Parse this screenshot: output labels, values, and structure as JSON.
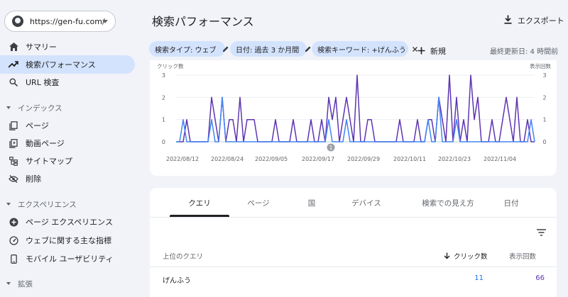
{
  "sidebar": {
    "property": "https://gen-fu.com/",
    "items": [
      {
        "label": "サマリー",
        "icon": "home-icon"
      },
      {
        "label": "検索パフォーマンス",
        "icon": "trending-icon",
        "active": true
      },
      {
        "label": "URL 検査",
        "icon": "search-icon"
      }
    ],
    "sections": [
      {
        "label": "インデックス",
        "items": [
          {
            "label": "ページ",
            "icon": "pages-icon"
          },
          {
            "label": "動画ページ",
            "icon": "video-page-icon"
          },
          {
            "label": "サイトマップ",
            "icon": "sitemap-icon"
          },
          {
            "label": "削除",
            "icon": "removal-icon"
          }
        ]
      },
      {
        "label": "エクスペリエンス",
        "items": [
          {
            "label": "ページ エクスペリエンス",
            "icon": "plus-circle-icon"
          },
          {
            "label": "ウェブに関する主な指標",
            "icon": "gauge-icon"
          },
          {
            "label": "モバイル ユーザビリティ",
            "icon": "mobile-icon"
          }
        ]
      },
      {
        "label": "拡張",
        "items": []
      }
    ]
  },
  "header": {
    "title": "検索パフォーマンス",
    "export_label": "エクスポート"
  },
  "filters": {
    "chips": [
      "検索タイプ: ウェブ",
      "日付: 過去 3 か月間",
      "検索キーワード: +げんふう"
    ],
    "new_label": "新規",
    "last_updated": "最終更新日: 4 時間前"
  },
  "chart_data": {
    "type": "line",
    "ylabel_left": "クリック数",
    "ylabel_right": "表示回数",
    "yticks_left": [
      "3",
      "2",
      "1",
      "0"
    ],
    "yticks_right": [
      "3",
      "2",
      "1",
      "0"
    ],
    "ylim": [
      0,
      3
    ],
    "x_tick_labels": [
      "2022/08/12",
      "2022/08/24",
      "2022/09/05",
      "2022/09/17",
      "2022/09/29",
      "2022/10/11",
      "2022/10/23",
      "2022/11/04"
    ],
    "annotation": "1",
    "series": [
      {
        "name": "クリック数",
        "color": "#4285f4",
        "values": [
          0,
          0,
          1,
          0,
          0,
          0,
          0,
          0,
          0,
          0,
          1,
          0,
          0,
          2,
          0,
          0,
          0,
          0,
          0,
          0,
          0,
          0,
          0,
          0,
          0,
          0,
          0,
          0,
          0,
          0,
          0,
          0,
          0,
          0,
          0,
          0,
          0,
          0,
          0,
          0,
          0,
          0,
          0,
          1,
          0,
          0,
          0,
          0,
          1,
          0,
          0,
          0,
          0,
          0,
          0,
          0,
          0,
          0,
          0,
          0,
          0,
          0,
          0,
          0,
          0,
          0,
          0,
          0,
          0,
          0,
          0,
          1,
          0,
          0,
          2,
          0,
          0,
          0,
          0,
          1,
          0,
          0,
          0,
          0,
          0,
          0,
          0,
          0,
          0,
          0,
          0,
          0,
          0,
          0,
          0,
          0,
          0,
          0,
          0,
          0,
          1,
          0
        ]
      },
      {
        "name": "表示回数",
        "color": "#5e35b1",
        "values": [
          0,
          0,
          0,
          1,
          0,
          0,
          0,
          0,
          0,
          0,
          2,
          1,
          0,
          2,
          0,
          1,
          1,
          0,
          2,
          0,
          1,
          1,
          1,
          0,
          0,
          0,
          0,
          0,
          1,
          0,
          0,
          0,
          0,
          1,
          0,
          0,
          0,
          0,
          1,
          0,
          0,
          1,
          0,
          2,
          1,
          2,
          0,
          1,
          2,
          1,
          0,
          3,
          0,
          0,
          1,
          1,
          0,
          0,
          0,
          0,
          0,
          0,
          0,
          1,
          0,
          0,
          0,
          0,
          1,
          0,
          0,
          1,
          1,
          0,
          2,
          1,
          0,
          3,
          0,
          2,
          0,
          1,
          0,
          3,
          1,
          2,
          0,
          0,
          0,
          1,
          0,
          0,
          1,
          2,
          1,
          0,
          2,
          0,
          0,
          1,
          0,
          0
        ]
      }
    ]
  },
  "table": {
    "tabs": [
      "クエリ",
      "ページ",
      "国",
      "デバイス",
      "検索での見え方",
      "日付"
    ],
    "header_query": "上位のクエリ",
    "header_clicks": "クリック数",
    "header_impressions": "表示回数",
    "rows": [
      {
        "query": "げんふう",
        "clicks": "11",
        "impressions": "66"
      }
    ],
    "clicks_color": "#1a73e8",
    "impressions_color": "#5e35b1"
  }
}
